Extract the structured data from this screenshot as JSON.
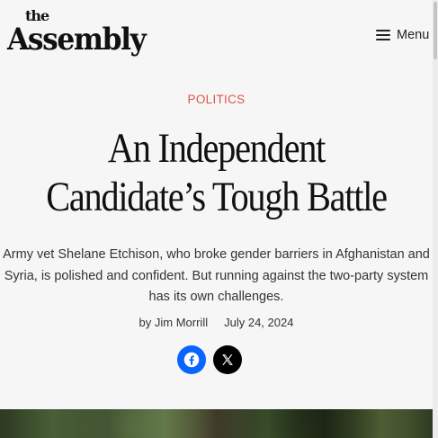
{
  "header": {
    "logo_top": "the",
    "logo_main": "Assembly",
    "menu_label": "Menu"
  },
  "article": {
    "category": "POLITICS",
    "headline": "An Independent Candidate’s Tough Battle",
    "dek": "Army vet Shelane Etchison, who broke gender barriers in Afghanistan and Syria, is polished and confident. But running against the two-party system has its own challenges.",
    "byline_prefix": "by",
    "author": "Jim Morrill",
    "date": "July 24, 2024"
  },
  "share": {
    "icons": [
      "facebook-icon",
      "x-icon"
    ]
  },
  "colors": {
    "category": "#e1544a",
    "facebook": "#0866ff",
    "x": "#000000",
    "background": "#f6f6f6"
  }
}
